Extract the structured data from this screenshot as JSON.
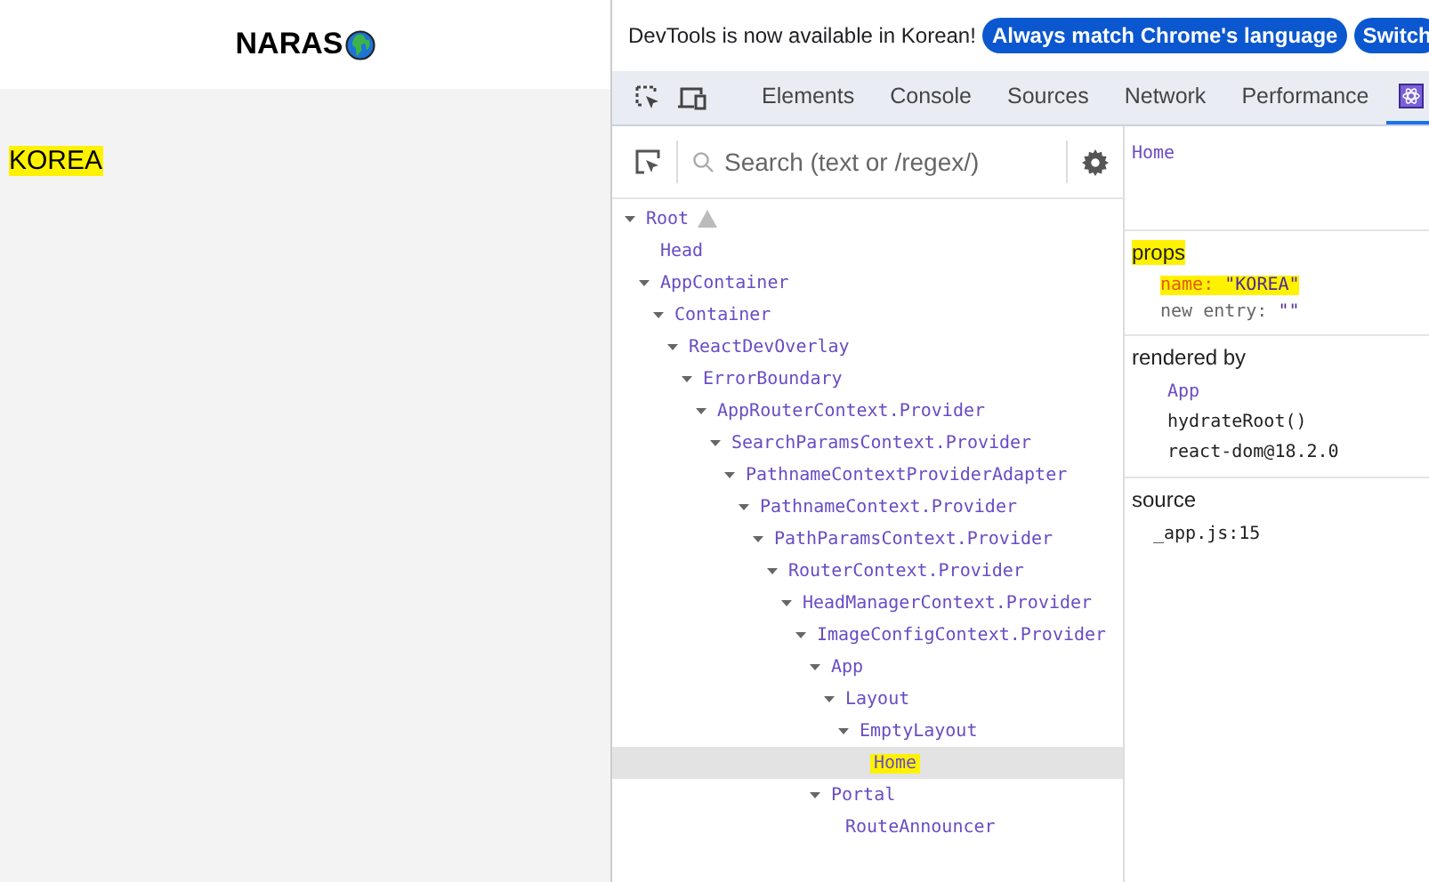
{
  "page": {
    "logo": "NARAS",
    "content": {
      "text": "KOREA",
      "highlighted": true
    }
  },
  "infobar": {
    "message": "DevTools is now available in Korean!",
    "buttons": [
      "Always match Chrome's language",
      "Switch"
    ]
  },
  "tabs": [
    {
      "kind": "text",
      "label": "Elements",
      "selected": false
    },
    {
      "kind": "text",
      "label": "Console",
      "selected": false
    },
    {
      "kind": "text",
      "label": "Sources",
      "selected": false
    },
    {
      "kind": "text",
      "label": "Network",
      "selected": false
    },
    {
      "kind": "text",
      "label": "Performance",
      "selected": false
    },
    {
      "kind": "icon",
      "selected": true
    }
  ],
  "search": {
    "placeholder": "Search (text or /regex/)"
  },
  "tree": [
    {
      "name": "Root",
      "warning": true,
      "expanded": true,
      "selected": false,
      "highlighted": false,
      "children": [
        {
          "name": "Head",
          "selected": false,
          "highlighted": false
        },
        {
          "name": "AppContainer",
          "expanded": true,
          "selected": false,
          "highlighted": false,
          "children": [
            {
              "name": "Container",
              "expanded": true,
              "selected": false,
              "highlighted": false,
              "children": [
                {
                  "name": "ReactDevOverlay",
                  "expanded": true,
                  "selected": false,
                  "highlighted": false,
                  "children": [
                    {
                      "name": "ErrorBoundary",
                      "expanded": true,
                      "selected": false,
                      "highlighted": false,
                      "children": [
                        {
                          "name": "AppRouterContext.Provider",
                          "expanded": true,
                          "selected": false,
                          "highlighted": false,
                          "children": [
                            {
                              "name": "SearchParamsContext.Provider",
                              "expanded": true,
                              "selected": false,
                              "highlighted": false,
                              "children": [
                                {
                                  "name": "PathnameContextProviderAdapter",
                                  "expanded": true,
                                  "selected": false,
                                  "highlighted": false,
                                  "children": [
                                    {
                                      "name": "PathnameContext.Provider",
                                      "expanded": true,
                                      "selected": false,
                                      "highlighted": false,
                                      "children": [
                                        {
                                          "name": "PathParamsContext.Provider",
                                          "expanded": true,
                                          "selected": false,
                                          "highlighted": false,
                                          "children": [
                                            {
                                              "name": "RouterContext.Provider",
                                              "expanded": true,
                                              "selected": false,
                                              "highlighted": false,
                                              "children": [
                                                {
                                                  "name": "HeadManagerContext.Provider",
                                                  "expanded": true,
                                                  "selected": false,
                                                  "highlighted": false,
                                                  "children": [
                                                    {
                                                      "name": "ImageConfigContext.Provider",
                                                      "expanded": true,
                                                      "selected": false,
                                                      "highlighted": false,
                                                      "children": [
                                                        {
                                                          "name": "App",
                                                          "expanded": true,
                                                          "selected": false,
                                                          "highlighted": false,
                                                          "children": [
                                                            {
                                                              "name": "Layout",
                                                              "expanded": true,
                                                              "selected": false,
                                                              "highlighted": false,
                                                              "children": [
                                                                {
                                                                  "name": "EmptyLayout",
                                                                  "expanded": true,
                                                                  "selected": false,
                                                                  "highlighted": false,
                                                                  "children": [
                                                                    {
                                                                      "name": "Home",
                                                                      "selected": true,
                                                                      "highlighted": true
                                                                    }
                                                                  ]
                                                                }
                                                              ]
                                                            }
                                                          ]
                                                        },
                                                        {
                                                          "name": "Portal",
                                                          "expanded": true,
                                                          "selected": false,
                                                          "highlighted": false,
                                                          "children": [
                                                            {
                                                              "name": "RouteAnnouncer",
                                                              "selected": false,
                                                              "highlighted": false
                                                            }
                                                          ]
                                                        }
                                                      ]
                                                    }
                                                  ]
                                                }
                                              ]
                                            }
                                          ]
                                        }
                                      ]
                                    }
                                  ]
                                }
                              ]
                            }
                          ]
                        }
                      ]
                    }
                  ]
                }
              ]
            }
          ]
        }
      ]
    }
  ],
  "inspector": {
    "component": "Home",
    "props": {
      "title": "props",
      "highlighted": true,
      "items": [
        {
          "key": "name:",
          "value": "\"KOREA\"",
          "highlighted": true
        },
        {
          "key": "new entry:",
          "value": "\"\"",
          "highlighted": false
        }
      ]
    },
    "rendered_by": {
      "title": "rendered by",
      "items": [
        {
          "kind": "component",
          "text": "App"
        },
        {
          "kind": "plain",
          "text": "hydrateRoot()"
        },
        {
          "kind": "plain",
          "text": "react-dom@18.2.0"
        }
      ]
    },
    "source": {
      "title": "source",
      "text": "_app.js:15"
    }
  }
}
